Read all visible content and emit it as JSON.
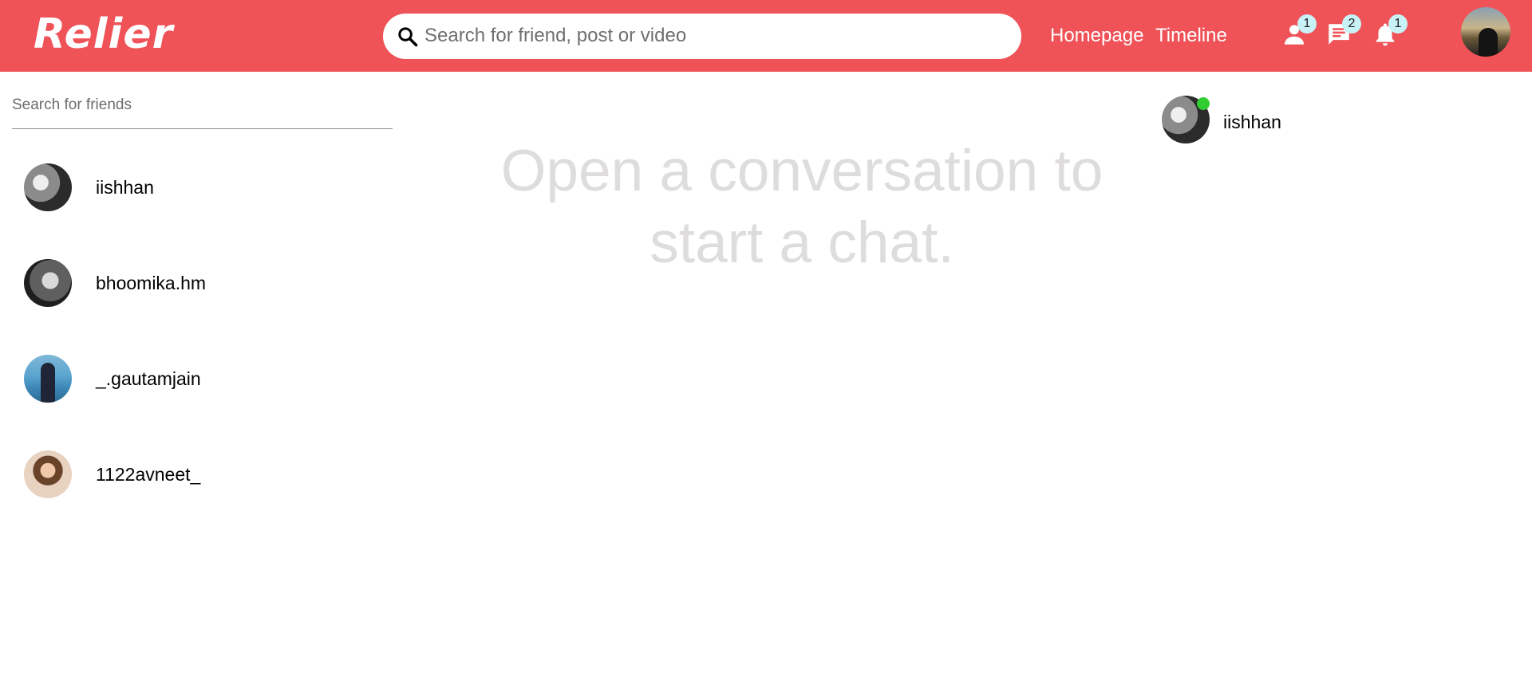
{
  "topbar": {
    "logo": "Relier",
    "search_placeholder": "Search for friend, post or video",
    "links": {
      "homepage": "Homepage",
      "timeline": "Timeline"
    },
    "badges": {
      "friend_requests": "1",
      "messages": "2",
      "notifications": "1"
    },
    "icons": [
      "search-icon",
      "person-icon",
      "chat-icon",
      "bell-icon"
    ],
    "accent_color": "#ef5257"
  },
  "sidebar": {
    "search_placeholder": "Search for friends",
    "friends": [
      {
        "name": "iishhan"
      },
      {
        "name": "bhoomika.hm"
      },
      {
        "name": "_.gautamjain"
      },
      {
        "name": "1122avneet_"
      }
    ]
  },
  "main": {
    "empty_message": "Open a conversation to start a chat."
  },
  "online": {
    "friends": [
      {
        "name": "iishhan",
        "status_color": "#32cd32"
      }
    ]
  }
}
